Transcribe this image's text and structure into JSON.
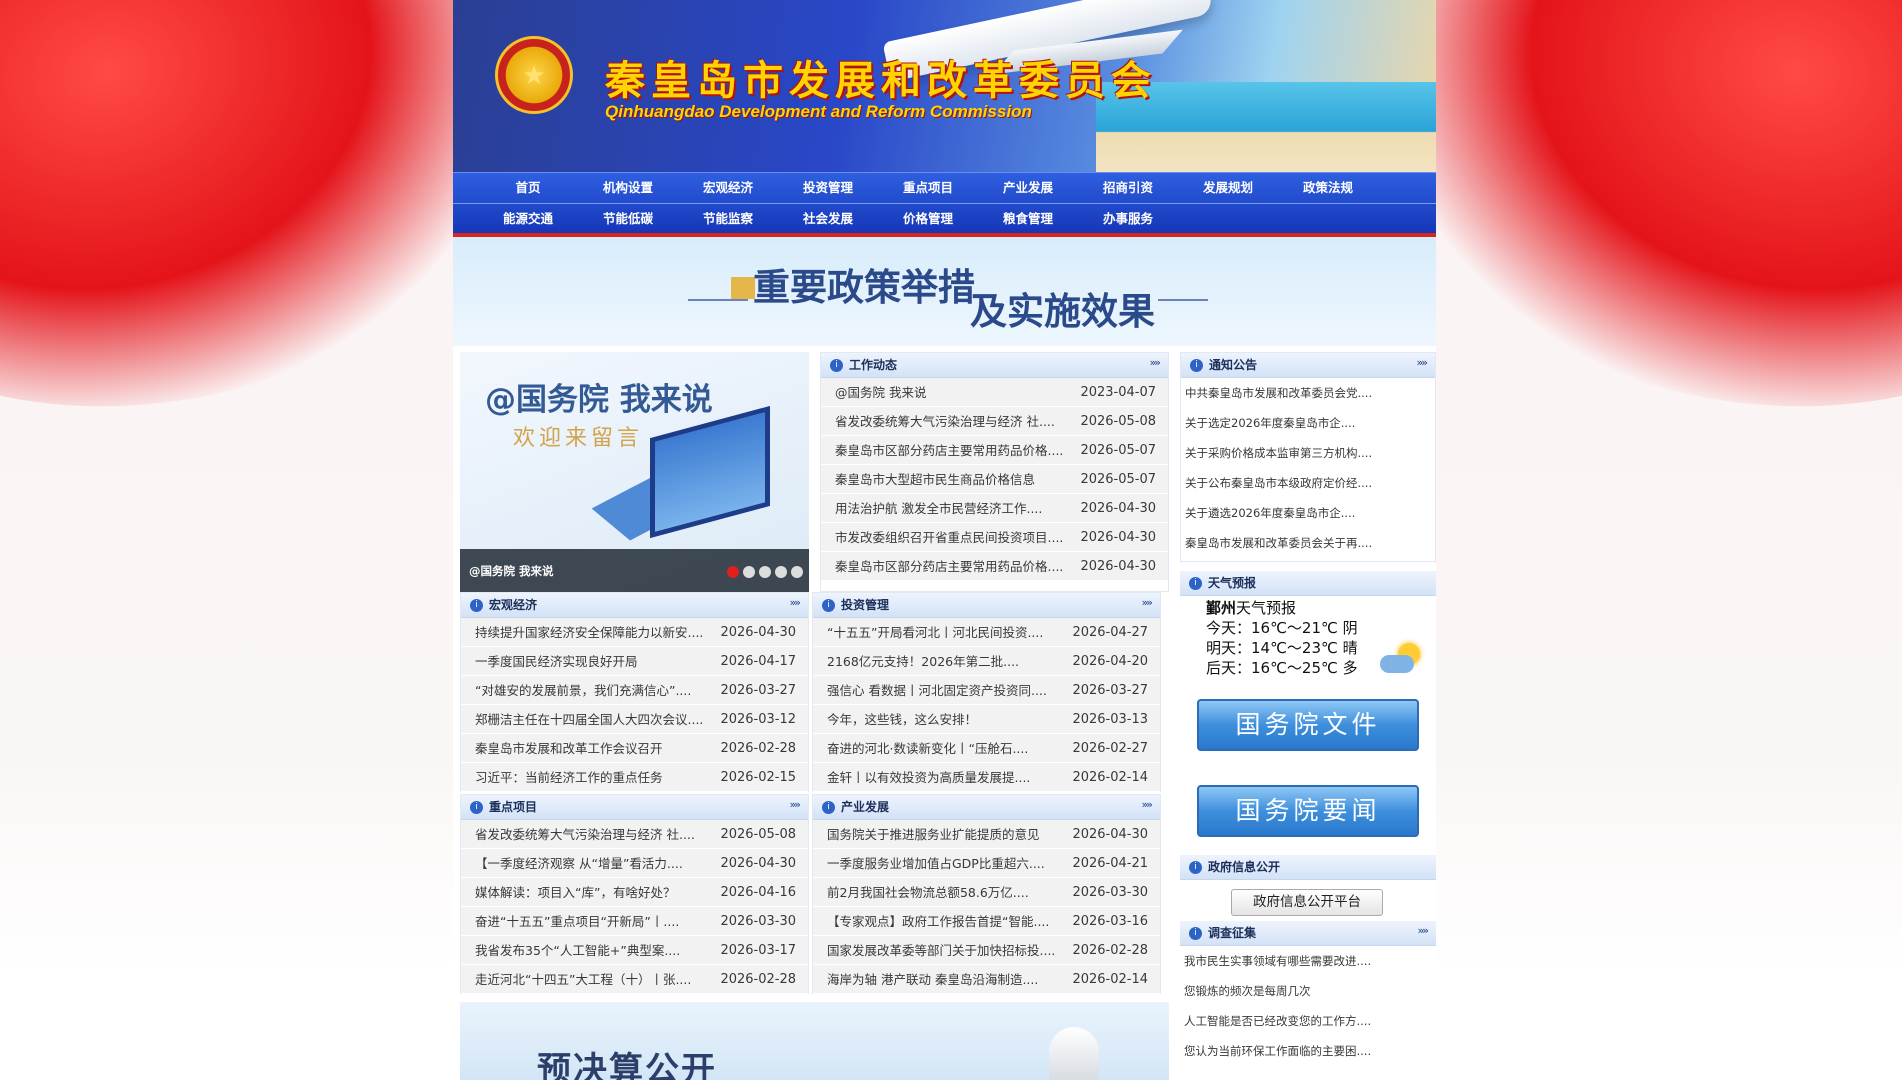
{
  "header": {
    "emblem_glyph": "★",
    "title_cn": "秦皇岛市发展和改革委员会",
    "title_en": "Qinhuangdao Development and Reform Commission"
  },
  "nav": {
    "row1": [
      "首页",
      "机构设置",
      "宏观经济",
      "投资管理",
      "重点项目",
      "产业发展",
      "招商引资",
      "发展规划",
      "政策法规"
    ],
    "row2": [
      "能源交通",
      "节能低碳",
      "节能监察",
      "社会发展",
      "价格管理",
      "粮食管理",
      "办事服务"
    ]
  },
  "banner": {
    "text_1": "重要政策举措",
    "text_2": "及实施效果"
  },
  "slider": {
    "headline": "@国务院 我来说",
    "subline": "欢迎来留言",
    "caption": "@国务院 我来说",
    "dots": 5,
    "active_dot": 0
  },
  "more_glyph": "»»",
  "icon_glyph": "i",
  "work": {
    "title": "工作动态",
    "items": [
      {
        "t": "@国务院 我来说",
        "d": "2023-04-07"
      },
      {
        "t": "省发改委统筹大气污染治理与经济 社....",
        "d": "2026-05-08"
      },
      {
        "t": "秦皇岛市区部分药店主要常用药品价格....",
        "d": "2026-05-07"
      },
      {
        "t": "秦皇岛市大型超市民生商品价格信息",
        "d": "2026-05-07"
      },
      {
        "t": "用法治护航 激发全市民营经济工作....",
        "d": "2026-04-30"
      },
      {
        "t": "市发改委组织召开省重点民间投资项目....",
        "d": "2026-04-30"
      },
      {
        "t": "秦皇岛市区部分药店主要常用药品价格....",
        "d": "2026-04-30"
      }
    ]
  },
  "notice": {
    "title": "通知公告",
    "items": [
      "中共秦皇岛市发展和改革委员会党....",
      "关于选定2026年度秦皇岛市企....",
      "关于采购价格成本监审第三方机构....",
      "关于公布秦皇岛市本级政府定价经....",
      "关于遴选2026年度秦皇岛市企....",
      "秦皇岛市发展和改革委员会关于再...."
    ]
  },
  "macro": {
    "title": "宏观经济",
    "items": [
      {
        "t": "持续提升国家经济安全保障能力以新安....",
        "d": "2026-04-30"
      },
      {
        "t": "一季度国民经济实现良好开局",
        "d": "2026-04-17"
      },
      {
        "t": "“对雄安的发展前景，我们充满信心”....",
        "d": "2026-03-27"
      },
      {
        "t": "郑栅洁主任在十四届全国人大四次会议....",
        "d": "2026-03-12"
      },
      {
        "t": "秦皇岛市发展和改革工作会议召开",
        "d": "2026-02-28"
      },
      {
        "t": "习近平：当前经济工作的重点任务",
        "d": "2026-02-15"
      }
    ]
  },
  "invest": {
    "title": "投资管理",
    "items": [
      {
        "t": "“十五五”开局看河北丨河北民间投资....",
        "d": "2026-04-27"
      },
      {
        "t": "2168亿元支持！2026年第二批....",
        "d": "2026-04-20"
      },
      {
        "t": "强信心 看数据丨河北固定资产投资同....",
        "d": "2026-03-27"
      },
      {
        "t": "今年，这些钱，这么安排！",
        "d": "2026-03-13"
      },
      {
        "t": "奋进的河北·数读新变化丨“压舱石....",
        "d": "2026-02-27"
      },
      {
        "t": "金轩丨以有效投资为高质量发展提....",
        "d": "2026-02-14"
      }
    ]
  },
  "key": {
    "title": "重点项目",
    "items": [
      {
        "t": "省发改委统筹大气污染治理与经济 社....",
        "d": "2026-05-08"
      },
      {
        "t": "【一季度经济观察 从“增量”看活力....",
        "d": "2026-04-30"
      },
      {
        "t": "媒体解读：项目入“库”，有啥好处？",
        "d": "2026-04-16"
      },
      {
        "t": "奋进“十五五”重点项目“开新局”丨....",
        "d": "2026-03-30"
      },
      {
        "t": "我省发布35个“人工智能+”典型案....",
        "d": "2026-03-17"
      },
      {
        "t": "走近河北“十四五”大工程（十）丨张....",
        "d": "2026-02-28"
      }
    ]
  },
  "industry": {
    "title": "产业发展",
    "items": [
      {
        "t": "国务院关于推进服务业扩能提质的意见",
        "d": "2026-04-30"
      },
      {
        "t": "一季度服务业增加值占GDP比重超六....",
        "d": "2026-04-21"
      },
      {
        "t": "前2月我国社会物流总额58.6万亿....",
        "d": "2026-03-30"
      },
      {
        "t": "【专家观点】政府工作报告首提“智能....",
        "d": "2026-03-16"
      },
      {
        "t": "国家发展改革委等部门关于加快招标投....",
        "d": "2026-02-28"
      },
      {
        "t": "海岸为轴 港产联动 秦皇岛沿海制造....",
        "d": "2026-02-14"
      }
    ]
  },
  "weather": {
    "title": "天气预报",
    "city": "鄞州",
    "label": "天气预报",
    "today": "今天：16℃～21℃ 阴",
    "tomorrow": "明天：14℃～23℃ 晴",
    "after": "后天：16℃～25℃ 多"
  },
  "buttons": {
    "state_docs": "国务院文件",
    "state_news": "国务院要闻"
  },
  "gov_info": {
    "title": "政府信息公开",
    "button": "政府信息公开平台"
  },
  "survey": {
    "title": "调查征集",
    "items": [
      "我市民生实事领域有哪些需要改进....",
      "您锻炼的频次是每周几次",
      "人工智能是否已经改变您的工作方....",
      "您认为当前环保工作面临的主要困...."
    ]
  },
  "budget": {
    "title": "预决算公开"
  }
}
